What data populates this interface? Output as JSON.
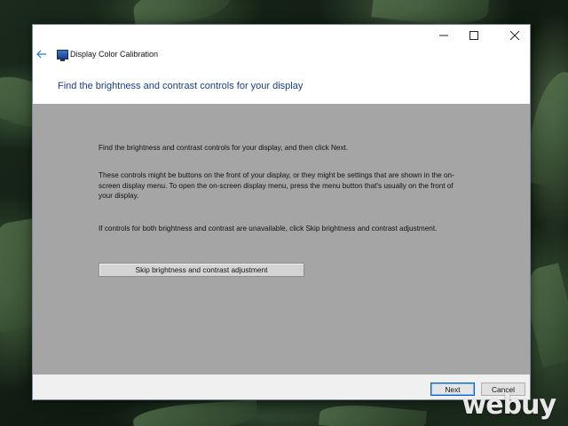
{
  "window": {
    "title": "Display Color Calibration",
    "heading": "Find the brightness and contrast controls for your display"
  },
  "content": {
    "paragraph1": "Find the brightness and contrast controls for your display, and then click Next.",
    "paragraph2": "These controls might be buttons on the front of your display, or they might be settings that are shown in the on-screen display menu. To open the on-screen display menu, press the menu button that's usually on the front of your display.",
    "paragraph3": "If controls for both brightness and contrast are unavailable, click Skip brightness and contrast adjustment.",
    "skip_button_label": "Skip brightness and contrast adjustment"
  },
  "footer": {
    "next_label": "Next",
    "cancel_label": "Cancel"
  },
  "desktop": {
    "watermark": "webuy"
  },
  "colors": {
    "heading": "#1a3d8c",
    "content_bg": "#a5a5a5",
    "accent": "#0a64c8"
  },
  "icons": {
    "back": "arrow-left-icon",
    "app": "monitor-icon",
    "minimize": "minimize-icon",
    "maximize": "maximize-icon",
    "close": "close-icon"
  }
}
